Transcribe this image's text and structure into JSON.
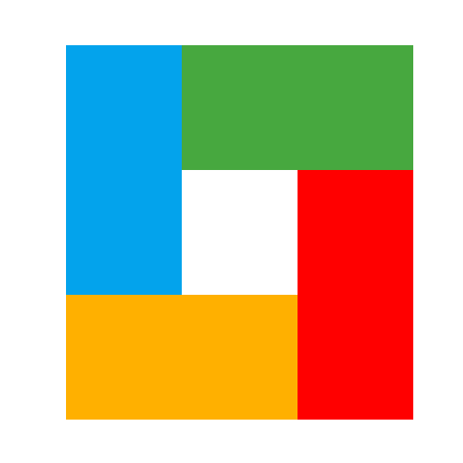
{
  "logo": {
    "name": "four-color-pinwheel-logo",
    "blocks": [
      {
        "id": "blue",
        "color": "#03A3EC"
      },
      {
        "id": "green",
        "color": "#47A83F"
      },
      {
        "id": "red",
        "color": "#FF0000"
      },
      {
        "id": "orange",
        "color": "#FFB000"
      }
    ],
    "center_color": "#FFFFFF"
  }
}
